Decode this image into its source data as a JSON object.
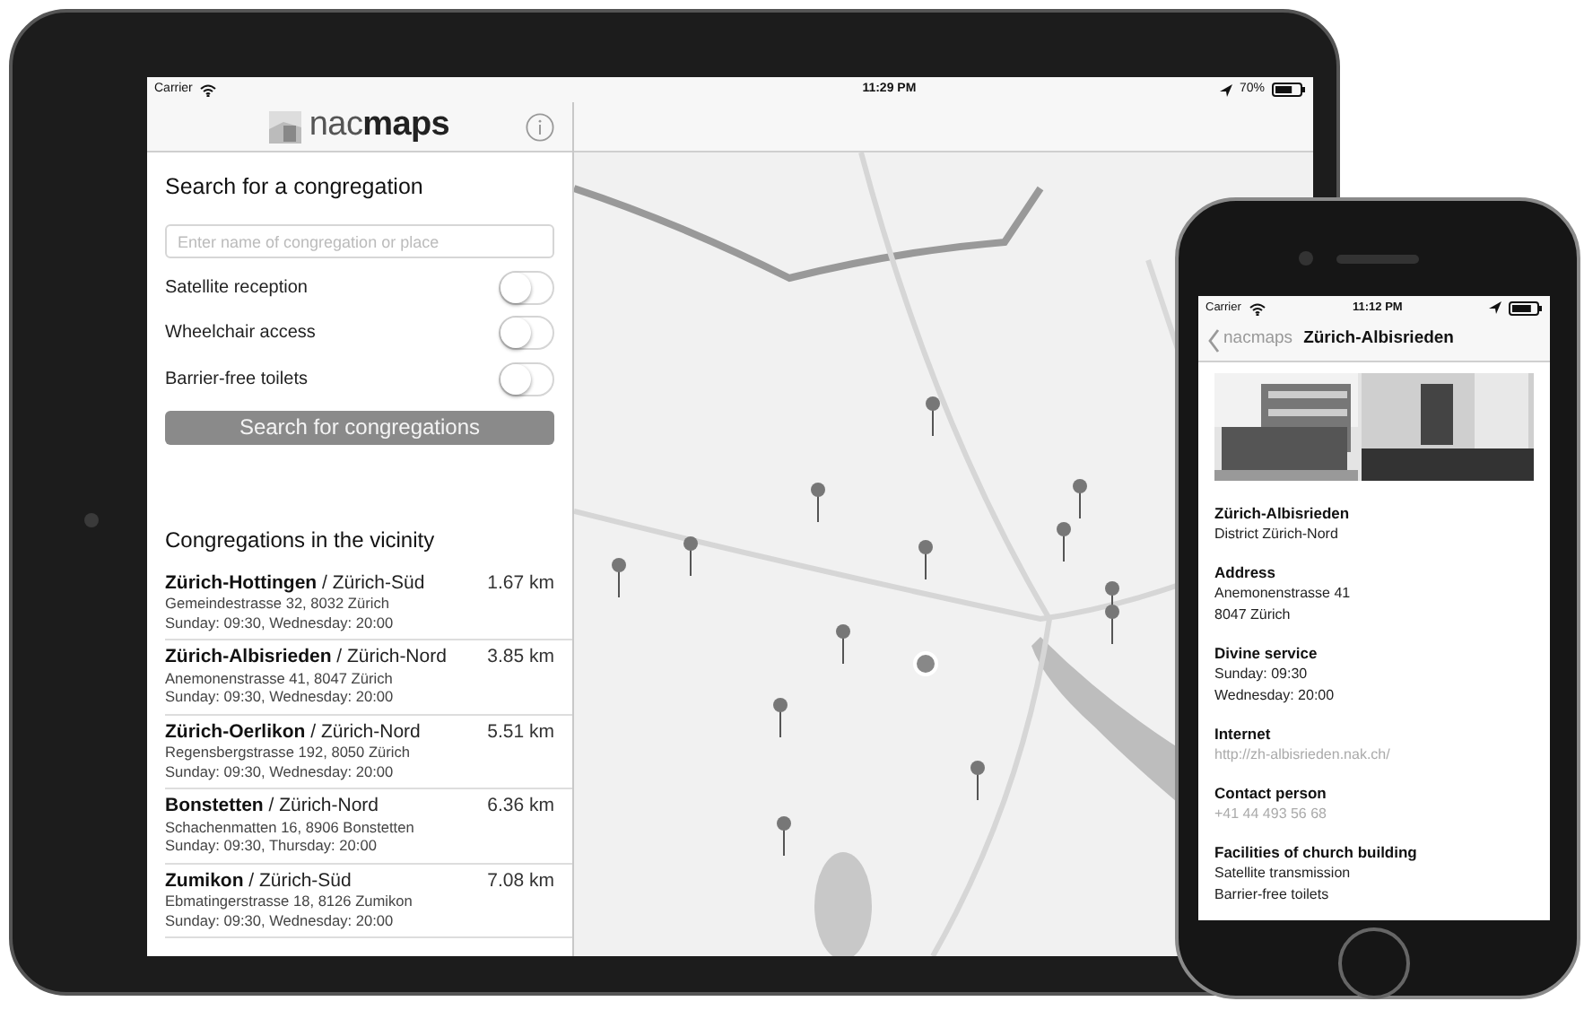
{
  "tablet": {
    "status_bar": {
      "carrier": "Carrier",
      "time": "11:29 PM",
      "battery": "70%"
    },
    "app_title": "nac**maps**",
    "search": {
      "heading": "Search for a congregation",
      "placeholder": "Enter name of congregation or place",
      "filters": [
        {
          "label": "Satellite reception",
          "on": false
        },
        {
          "label": "Wheelchair access",
          "on": false
        },
        {
          "label": "Barrier-free toilets",
          "on": false
        }
      ],
      "button": "Search for congregations"
    },
    "nearby": {
      "heading": "Congregations in the vicinity",
      "items": [
        {
          "title": "**Zürich-Hottingen** / Zürich-Süd",
          "address": "Gemeindestrasse 32, 8032 Zürich",
          "times": "Sunday: 09:30, Wednesday: 20:00",
          "distance": "1.67 km"
        },
        {
          "title": "**Zürich-Albisrieden** / Zürich-Nord",
          "address": "Anemonenstrasse 41, 8047 Zürich",
          "times": "Sunday: 09:30, Wednesday: 20:00",
          "distance": "3.85 km"
        },
        {
          "title": "**Zürich-Oerlikon** / Zürich-Nord",
          "address": "Regensbergstrasse 192, 8050 Zürich",
          "times": "Sunday: 09:30, Wednesday: 20:00",
          "distance": "5.51 km"
        },
        {
          "title": "**Bonstetten** / Zürich-Nord",
          "address": "Schachenmatten 16, 8906 Bonstetten",
          "times": "Sunday: 09:30, Thursday: 20:00",
          "distance": "6.36 km"
        },
        {
          "title": "**Zumikon** / Zürich-Süd",
          "address": "Ebmatingerstrasse 18, 8126 Zumikon",
          "times": "Sunday: 09:30, Wednesday: 20:00",
          "distance": "7.08 km"
        }
      ]
    }
  },
  "phone": {
    "status_bar": {
      "carrier": "Carrier",
      "time": "11:12 PM"
    },
    "back": "nacmaps",
    "title": "Zürich-Albisrieden",
    "sections": [
      {
        "heading": "Zürich-Albisrieden",
        "kind": "text",
        "lines": [
          "District Zürich-Nord"
        ]
      },
      {
        "heading": "Address",
        "kind": "text",
        "lines": [
          "Anemonenstrasse 41",
          "8047 Zürich"
        ]
      },
      {
        "heading": "Divine service",
        "kind": "text",
        "lines": [
          "Sunday: 09:30",
          "Wednesday: 20:00"
        ]
      },
      {
        "heading": "Internet",
        "kind": "link",
        "lines": [
          "http://zh-albisrieden.nak.ch/"
        ]
      },
      {
        "heading": "Contact person",
        "kind": "link",
        "lines": [
          "+41 44 493 56 68"
        ]
      },
      {
        "heading": "Facilities of church building",
        "kind": "text",
        "lines": [
          "Satellite transmission",
          "Barrier-free toilets"
        ]
      }
    ]
  }
}
